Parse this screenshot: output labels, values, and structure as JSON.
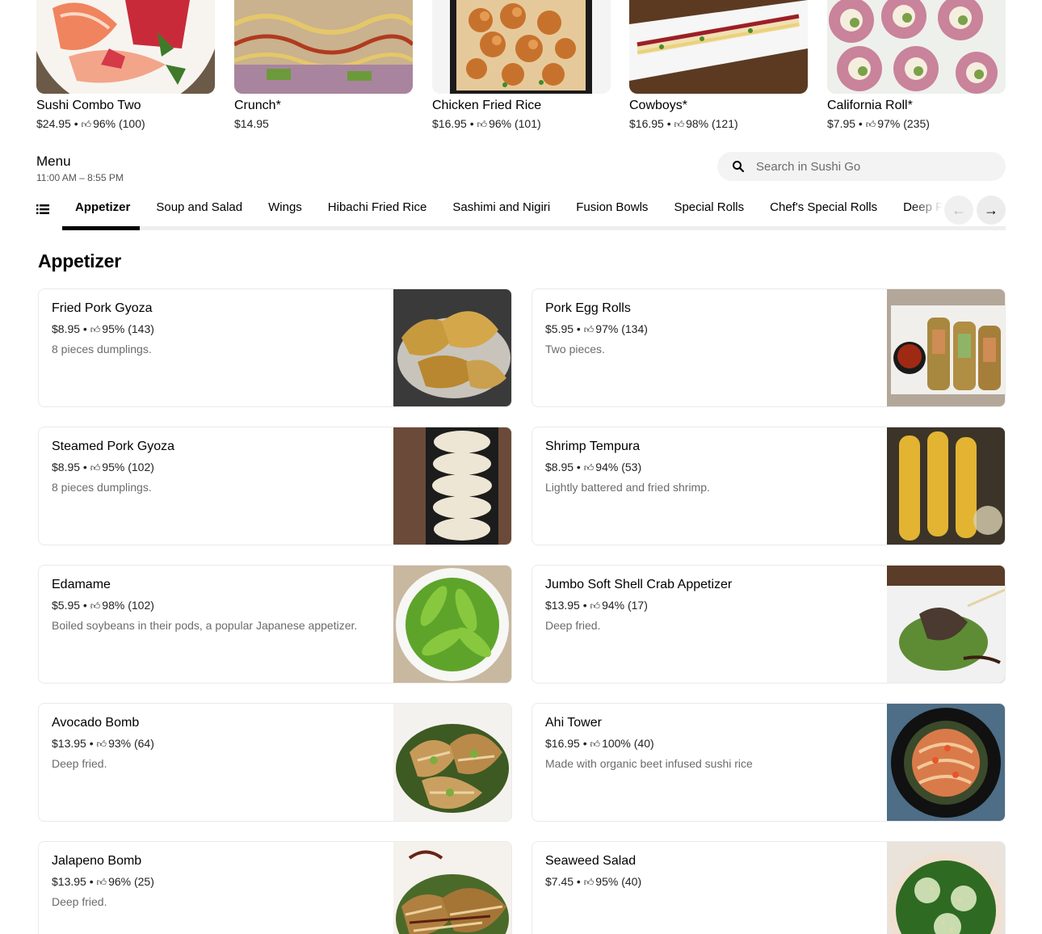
{
  "featured": [
    {
      "name": "Sushi Combo Two",
      "price": "$24.95",
      "rating": "96%",
      "count": "(100)"
    },
    {
      "name": "Crunch*",
      "price": "$14.95",
      "rating": "",
      "count": ""
    },
    {
      "name": "Chicken Fried Rice",
      "price": "$16.95",
      "rating": "96%",
      "count": "(101)"
    },
    {
      "name": "Cowboys*",
      "price": "$16.95",
      "rating": "98%",
      "count": "(121)"
    },
    {
      "name": "California Roll*",
      "price": "$7.95",
      "rating": "97%",
      "count": "(235)"
    }
  ],
  "menu": {
    "title": "Menu",
    "hours": "11:00 AM – 8:55 PM"
  },
  "search": {
    "placeholder": "Search in Sushi Go"
  },
  "categories": [
    "Appetizer",
    "Soup and Salad",
    "Wings",
    "Hibachi Fried Rice",
    "Sashimi and Nigiri",
    "Fusion Bowls",
    "Special Rolls",
    "Chef's Special Rolls",
    "Deep Fried"
  ],
  "active_category": "Appetizer",
  "section": {
    "title": "Appetizer"
  },
  "items": [
    {
      "name": "Fried Pork Gyoza",
      "price": "$8.95",
      "rating": "95%",
      "count": "(143)",
      "desc": "8 pieces dumplings."
    },
    {
      "name": "Pork Egg Rolls",
      "price": "$5.95",
      "rating": "97%",
      "count": "(134)",
      "desc": "Two pieces."
    },
    {
      "name": "Steamed Pork Gyoza",
      "price": "$8.95",
      "rating": "95%",
      "count": "(102)",
      "desc": "8 pieces dumplings."
    },
    {
      "name": "Shrimp Tempura",
      "price": "$8.95",
      "rating": "94%",
      "count": "(53)",
      "desc": "Lightly battered and fried shrimp."
    },
    {
      "name": "Edamame",
      "price": "$5.95",
      "rating": "98%",
      "count": "(102)",
      "desc": "Boiled soybeans in their pods, a popular Japanese appetizer."
    },
    {
      "name": "Jumbo Soft Shell Crab Appetizer",
      "price": "$13.95",
      "rating": "94%",
      "count": "(17)",
      "desc": "Deep fried."
    },
    {
      "name": "Avocado Bomb",
      "price": "$13.95",
      "rating": "93%",
      "count": "(64)",
      "desc": "Deep fried."
    },
    {
      "name": "Ahi Tower",
      "price": "$16.95",
      "rating": "100%",
      "count": "(40)",
      "desc": "Made with organic beet infused sushi rice"
    },
    {
      "name": "Jalapeno Bomb",
      "price": "$13.95",
      "rating": "96%",
      "count": "(25)",
      "desc": "Deep fried."
    },
    {
      "name": "Seaweed Salad",
      "price": "$7.45",
      "rating": "95%",
      "count": "(40)",
      "desc": ""
    }
  ]
}
